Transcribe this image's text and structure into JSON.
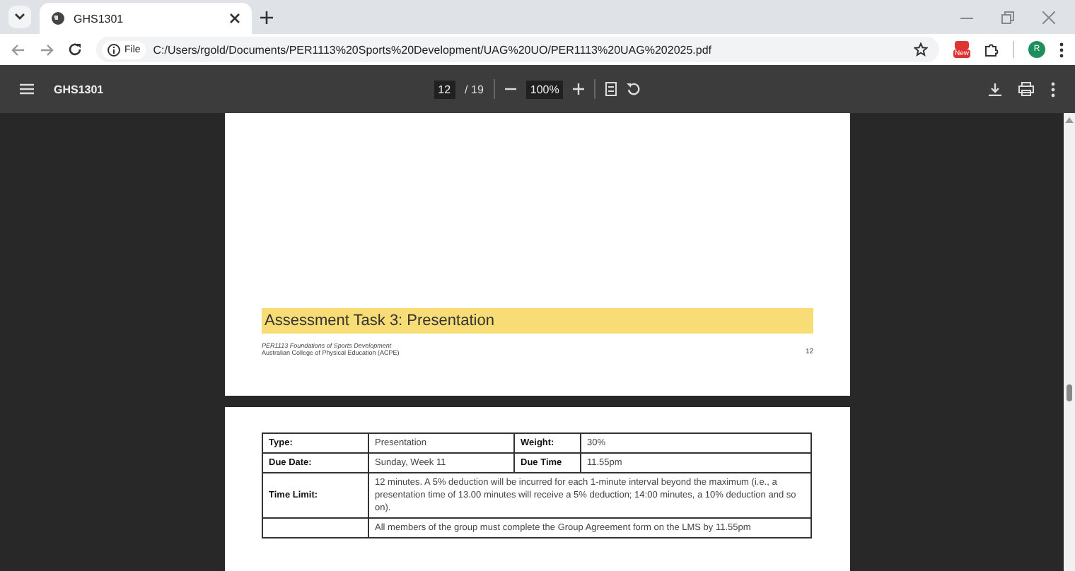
{
  "browser": {
    "tabs": [
      {
        "title": "GHS1301",
        "selected": true
      }
    ],
    "address": {
      "scheme_label": "File",
      "url": "C:/Users/rgold/Documents/PER1113%20Sports%20Development/UAG%20UO/PER1113%20UAG%202025.pdf"
    },
    "profile_initial": "R",
    "extension_badge": "New"
  },
  "pdf_toolbar": {
    "title": "GHS1301",
    "page": "12",
    "page_total": "/ 19",
    "zoom": "100%"
  },
  "pages": [
    {
      "heading": "Assessment Task 3: Presentation",
      "footer_course": "PER1113 Foundations of Sports Development",
      "footer_college": "Australian College of Physical Education (ACPE)",
      "page_number": "12"
    },
    {
      "table": [
        {
          "kind": "pair",
          "cells": [
            "Type:",
            "Presentation",
            "Weight:",
            "30%"
          ]
        },
        {
          "kind": "pair",
          "cells": [
            "Due Date:",
            "Sunday, Week 11",
            "Due Time",
            "11.55pm"
          ]
        },
        {
          "kind": "wide",
          "cells": [
            "Time Limit:",
            "12 minutes. A 5% deduction will be incurred for each 1-minute interval beyond the maximum (i.e., a presentation time of 13.00 minutes will receive a 5% deduction; 14:00 minutes, a 10% deduction and so on)."
          ]
        },
        {
          "kind": "wide",
          "cells": [
            "",
            "All members of the group must complete the Group Agreement form on the LMS by 11.55pm"
          ]
        }
      ]
    }
  ]
}
